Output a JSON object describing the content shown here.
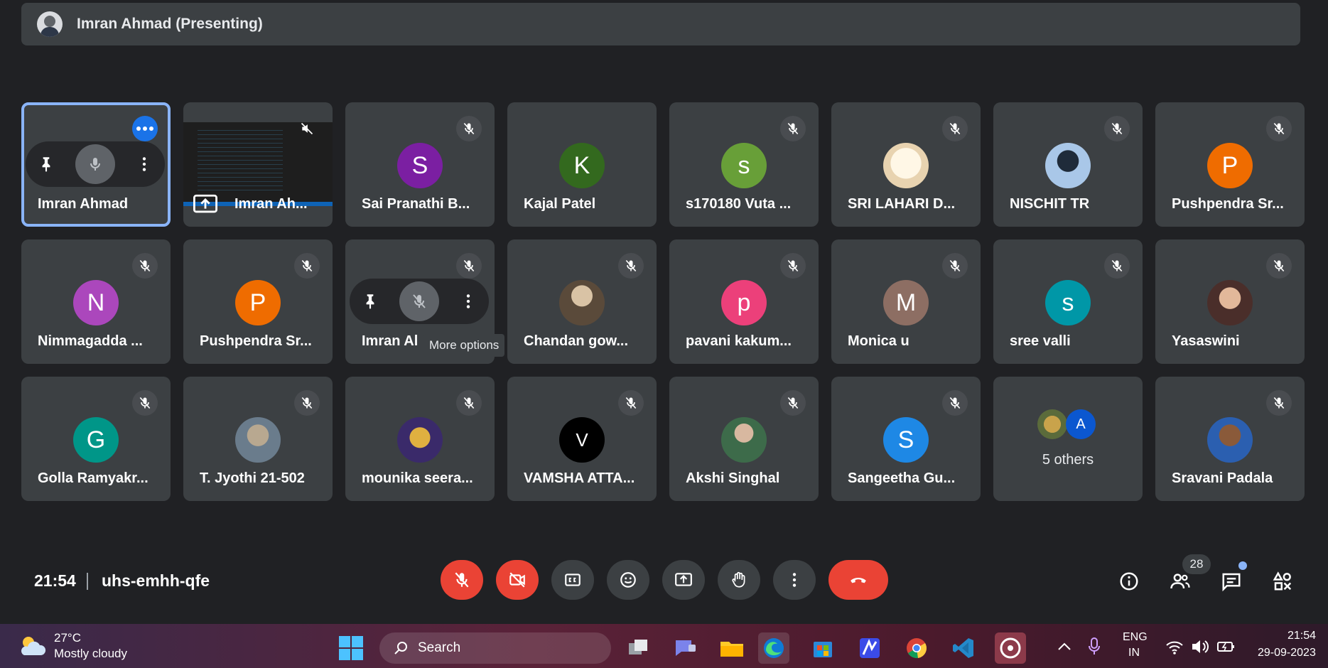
{
  "presenter": {
    "label": "Imran Ahmad (Presenting)"
  },
  "tiles": [
    {
      "name": "Imran Ahmad"
    },
    {
      "name": "Imran Ah..."
    },
    {
      "name": "Sai Pranathi B...",
      "initial": "S",
      "color": "#7b1fa2"
    },
    {
      "name": "Kajal Patel",
      "initial": "K",
      "color": "#33691e"
    },
    {
      "name": "s170180 Vuta ...",
      "initial": "s",
      "color": "#689f38"
    },
    {
      "name": "SRI LAHARI D..."
    },
    {
      "name": "NISCHIT TR"
    },
    {
      "name": "Pushpendra Sr...",
      "initial": "P",
      "color": "#ef6c00"
    },
    {
      "name": "Nimmagadda ...",
      "initial": "N",
      "color": "#ab47bc"
    },
    {
      "name": "Pushpendra Sr...",
      "initial": "P",
      "color": "#ef6c00"
    },
    {
      "name": "Imran Al"
    },
    {
      "name": "Chandan gow..."
    },
    {
      "name": "pavani kakum...",
      "initial": "p",
      "color": "#ec407a"
    },
    {
      "name": "Monica u",
      "initial": "M",
      "color": "#8d6e63"
    },
    {
      "name": "sree valli",
      "initial": "s",
      "color": "#0097a7"
    },
    {
      "name": "Yasaswini"
    },
    {
      "name": "Golla Ramyakr...",
      "initial": "G",
      "color": "#009688"
    },
    {
      "name": "T. Jyothi 21-502"
    },
    {
      "name": "mounika seera..."
    },
    {
      "name": "VAMSHA ATTA...",
      "initial": "V",
      "color": "#000000"
    },
    {
      "name": "Akshi Singhal"
    },
    {
      "name": "Sangeetha Gu...",
      "initial": "S",
      "color": "#1e88e5"
    },
    {
      "name": "5 others",
      "initial": "A"
    },
    {
      "name": "Sravani Padala"
    }
  ],
  "tooltip": "More options",
  "meeting": {
    "time": "21:54",
    "code": "uhs-emhh-qfe",
    "participant_count": "28"
  },
  "taskbar": {
    "temp": "27°C",
    "weather": "Mostly cloudy",
    "search": "Search",
    "lang1": "ENG",
    "lang2": "IN",
    "time": "21:54",
    "date": "29-09-2023"
  }
}
